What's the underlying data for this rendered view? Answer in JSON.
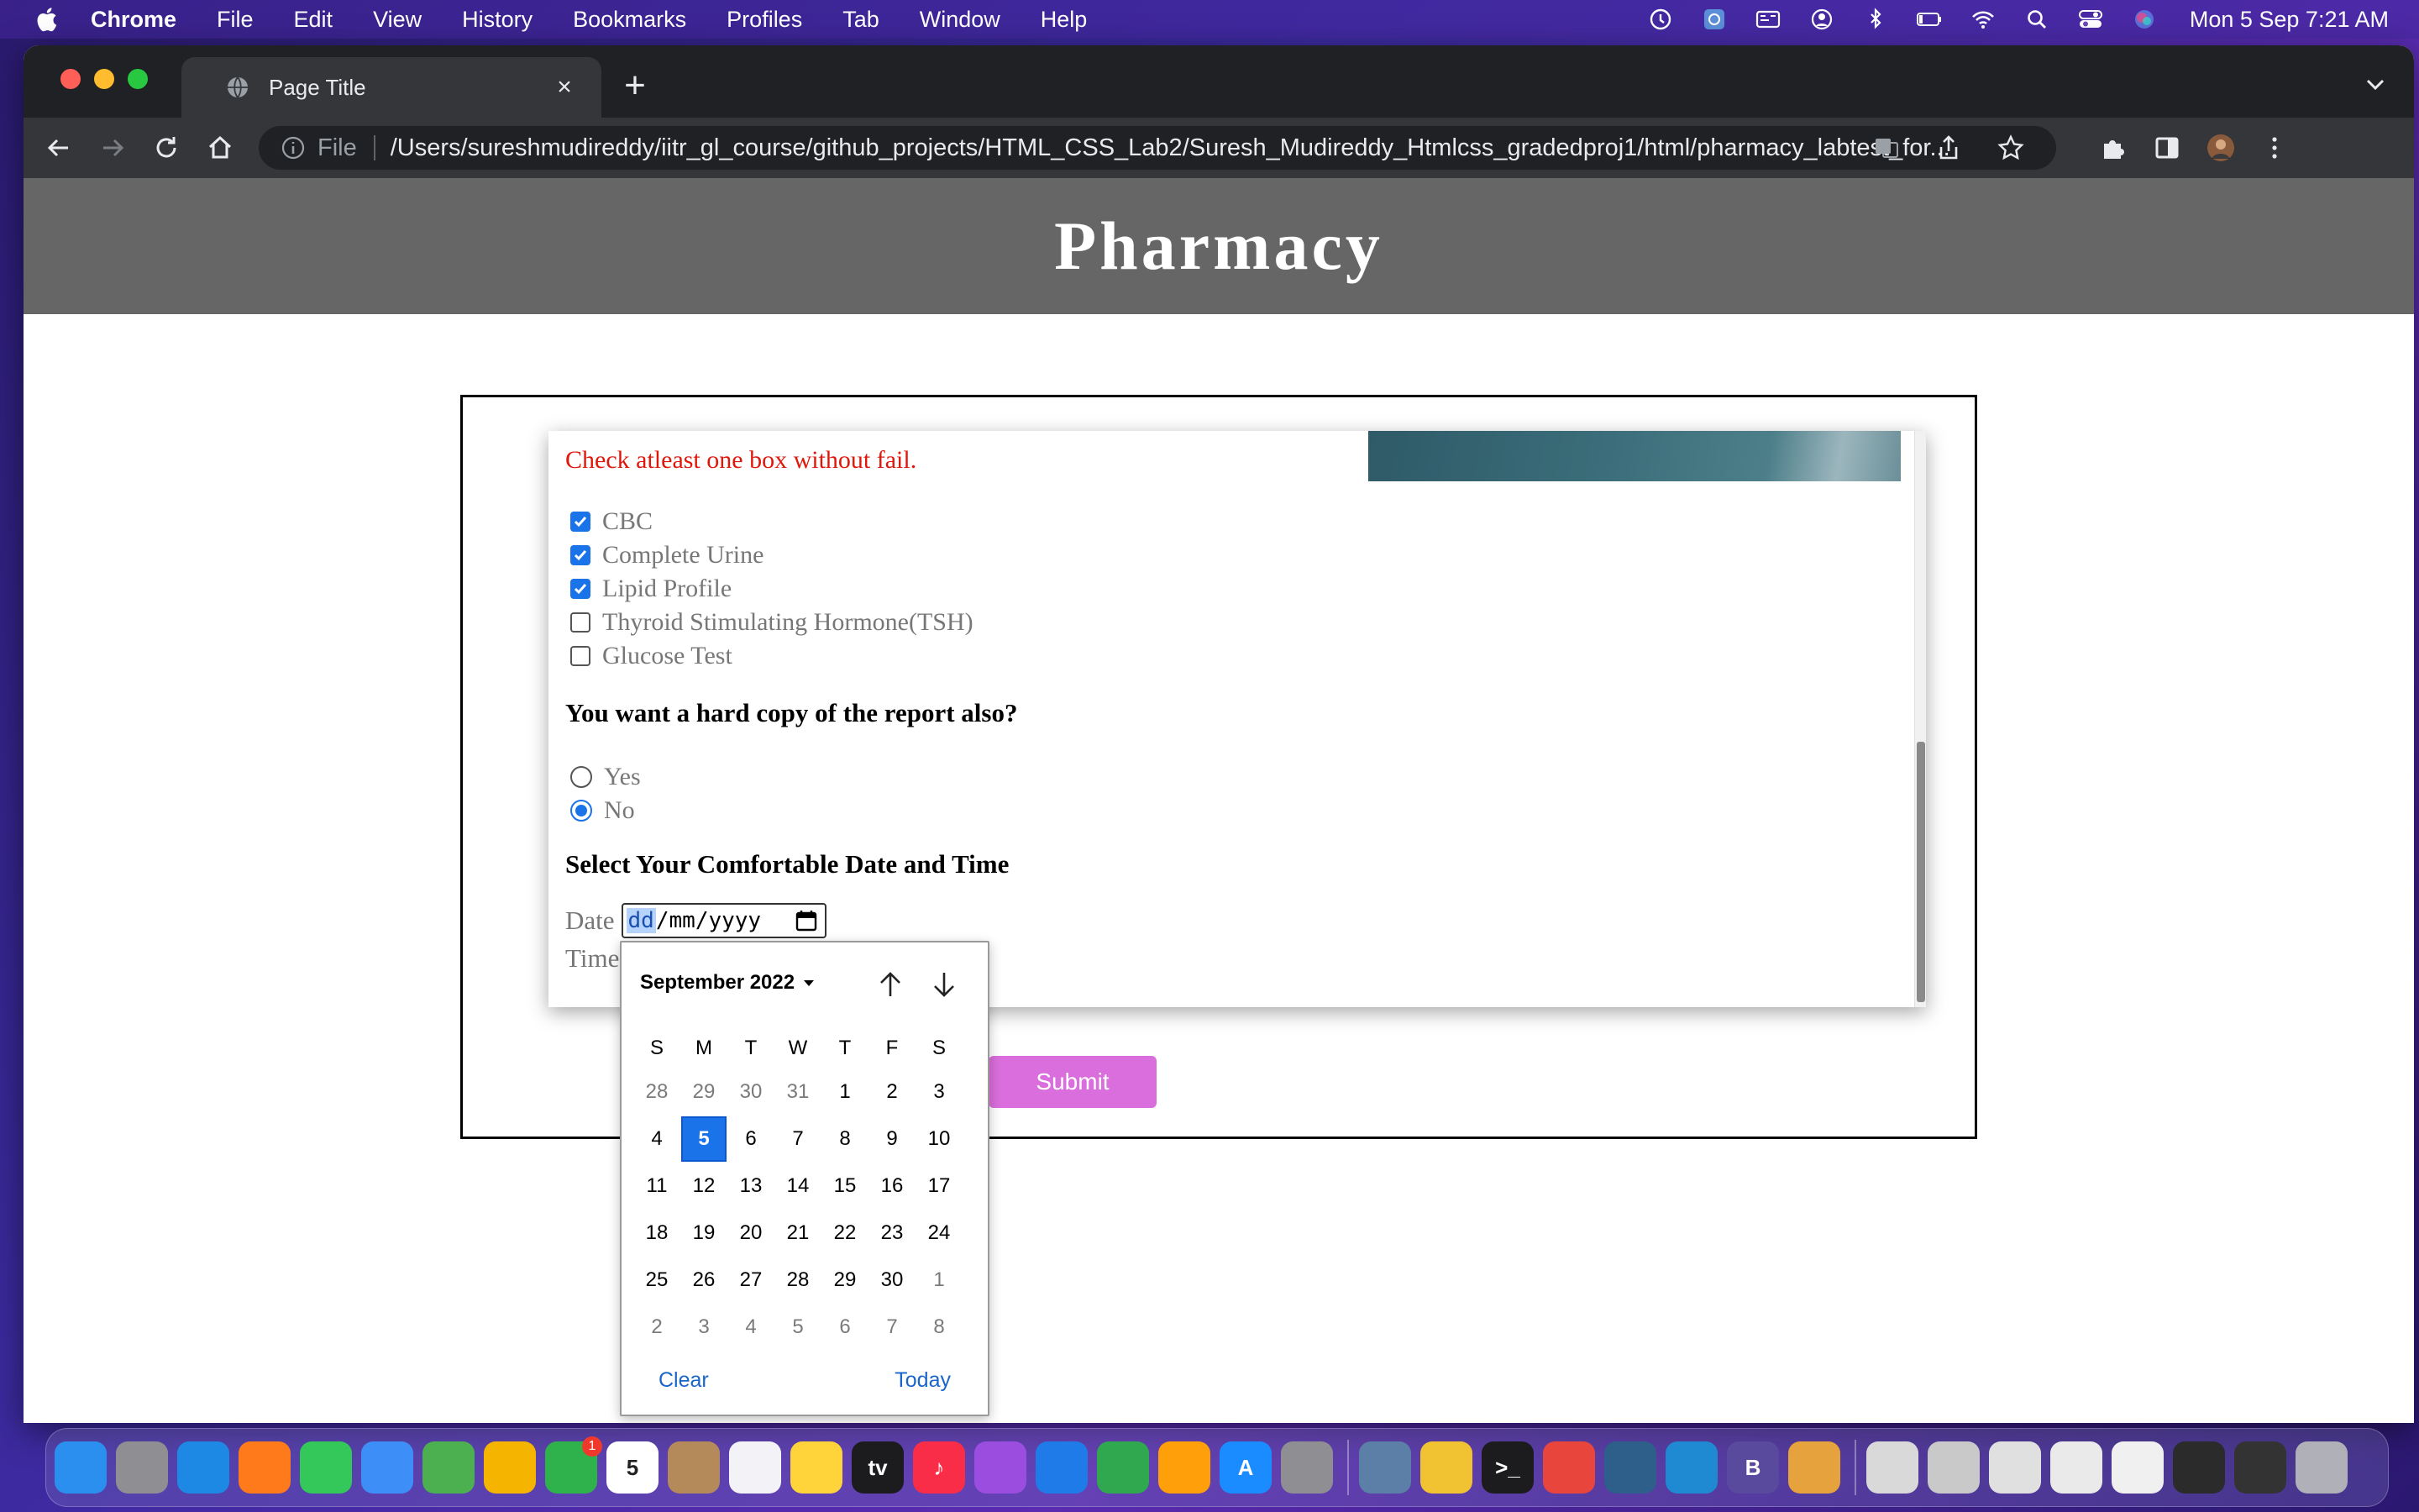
{
  "menubar": {
    "items": [
      "Chrome",
      "File",
      "Edit",
      "View",
      "History",
      "Bookmarks",
      "Profiles",
      "Tab",
      "Window",
      "Help"
    ],
    "clock": "Mon 5 Sep  7:21 AM"
  },
  "browser": {
    "tab_title": "Page Title",
    "url_scheme": "File",
    "url": "/Users/sureshmudireddy/iitr_gl_course/github_projects/HTML_CSS_Lab2/Suresh_Mudireddy_Htmlcss_gradedproj1/html/pharmacy_labtest_for..."
  },
  "page": {
    "heading": "Pharmacy",
    "warning": "Check atleast one box without fail.",
    "tests": [
      {
        "label": "CBC",
        "checked": true
      },
      {
        "label": "Complete Urine",
        "checked": true
      },
      {
        "label": "Lipid Profile",
        "checked": true
      },
      {
        "label": "Thyroid Stimulating Hormone(TSH)",
        "checked": false
      },
      {
        "label": "Glucose Test",
        "checked": false
      }
    ],
    "hardcopy_question": "You want a hard copy of the report also?",
    "hardcopy_options": [
      {
        "label": "Yes",
        "checked": false
      },
      {
        "label": "No",
        "checked": true
      }
    ],
    "datetime_heading": "Select Your Comfortable Date and Time",
    "date_label": "Date",
    "date_placeholder": {
      "dd": "dd",
      "mm": "mm",
      "yyyy": "yyyy"
    },
    "time_label": "Time",
    "submit_label": "Submit"
  },
  "datepicker": {
    "month_label": "September 2022",
    "weekdays": [
      "S",
      "M",
      "T",
      "W",
      "T",
      "F",
      "S"
    ],
    "weeks": [
      [
        {
          "d": "28",
          "m": true
        },
        {
          "d": "29",
          "m": true
        },
        {
          "d": "30",
          "m": true
        },
        {
          "d": "31",
          "m": true
        },
        {
          "d": "1"
        },
        {
          "d": "2"
        },
        {
          "d": "3"
        }
      ],
      [
        {
          "d": "4"
        },
        {
          "d": "5",
          "sel": true
        },
        {
          "d": "6"
        },
        {
          "d": "7"
        },
        {
          "d": "8"
        },
        {
          "d": "9"
        },
        {
          "d": "10"
        }
      ],
      [
        {
          "d": "11"
        },
        {
          "d": "12"
        },
        {
          "d": "13"
        },
        {
          "d": "14"
        },
        {
          "d": "15"
        },
        {
          "d": "16"
        },
        {
          "d": "17"
        }
      ],
      [
        {
          "d": "18"
        },
        {
          "d": "19"
        },
        {
          "d": "20"
        },
        {
          "d": "21"
        },
        {
          "d": "22"
        },
        {
          "d": "23"
        },
        {
          "d": "24"
        }
      ],
      [
        {
          "d": "25"
        },
        {
          "d": "26"
        },
        {
          "d": "27"
        },
        {
          "d": "28"
        },
        {
          "d": "29"
        },
        {
          "d": "30"
        },
        {
          "d": "1",
          "m": true
        }
      ],
      [
        {
          "d": "2",
          "m": true
        },
        {
          "d": "3",
          "m": true
        },
        {
          "d": "4",
          "m": true
        },
        {
          "d": "5",
          "m": true
        },
        {
          "d": "6",
          "m": true
        },
        {
          "d": "7",
          "m": true
        },
        {
          "d": "8",
          "m": true
        }
      ]
    ],
    "clear_label": "Clear",
    "today_label": "Today"
  },
  "dock": {
    "apps": [
      {
        "name": "finder",
        "color": "#2b8ff0",
        "glyph": ""
      },
      {
        "name": "launchpad",
        "color": "#8e8e93",
        "glyph": ""
      },
      {
        "name": "safari",
        "color": "#1e88e5",
        "glyph": ""
      },
      {
        "name": "firefox",
        "color": "#ff7a1a",
        "glyph": ""
      },
      {
        "name": "messages",
        "color": "#34c759",
        "glyph": ""
      },
      {
        "name": "mail",
        "color": "#3d8ef7",
        "glyph": ""
      },
      {
        "name": "maps",
        "color": "#4cb050",
        "glyph": ""
      },
      {
        "name": "photos",
        "color": "#f4b400",
        "glyph": ""
      },
      {
        "name": "facetime",
        "color": "#2fb24c",
        "glyph": "",
        "badge": "1"
      },
      {
        "name": "calendar",
        "color": "#ffffff",
        "glyph": "5"
      },
      {
        "name": "contacts",
        "color": "#b48a5a",
        "glyph": ""
      },
      {
        "name": "reminders",
        "color": "#f2f2f7",
        "glyph": ""
      },
      {
        "name": "notes",
        "color": "#ffd43b",
        "glyph": ""
      },
      {
        "name": "apple-tv",
        "color": "#1c1c1e",
        "glyph": "tv"
      },
      {
        "name": "music",
        "color": "#fa2d48",
        "glyph": "♪"
      },
      {
        "name": "podcasts",
        "color": "#9b4de0",
        "glyph": ""
      },
      {
        "name": "keynote",
        "color": "#1e7be8",
        "glyph": ""
      },
      {
        "name": "numbers",
        "color": "#2fa84f",
        "glyph": ""
      },
      {
        "name": "pages",
        "color": "#ff9f0a",
        "glyph": ""
      },
      {
        "name": "app-store",
        "color": "#1a8cff",
        "glyph": "A"
      },
      {
        "name": "system-preferences",
        "color": "#8e8e93",
        "glyph": ""
      },
      {
        "name": "sep"
      },
      {
        "name": "preview",
        "color": "#5b7fa6",
        "glyph": ""
      },
      {
        "name": "files",
        "color": "#f1c232",
        "glyph": ""
      },
      {
        "name": "terminal",
        "color": "#1c1c1e",
        "glyph": ">_"
      },
      {
        "name": "chrome",
        "color": "#e8453c",
        "glyph": ""
      },
      {
        "name": "mysql-workbench",
        "color": "#2e5f8a",
        "glyph": ""
      },
      {
        "name": "vscode",
        "color": "#1f8ad2",
        "glyph": ""
      },
      {
        "name": "bbedit",
        "color": "#5a4a9e",
        "glyph": "B"
      },
      {
        "name": "xcode-tool",
        "color": "#e6a23c",
        "glyph": ""
      },
      {
        "name": "sep"
      },
      {
        "name": "window-thumb-1",
        "color": "#d9d9d9",
        "glyph": ""
      },
      {
        "name": "window-thumb-2",
        "color": "#c9c9c9",
        "glyph": ""
      },
      {
        "name": "window-thumb-3",
        "color": "#e0e0e0",
        "glyph": ""
      },
      {
        "name": "window-thumb-4",
        "color": "#eaeaea",
        "glyph": ""
      },
      {
        "name": "window-thumb-5",
        "color": "#f0f0f0",
        "glyph": ""
      },
      {
        "name": "window-thumb-6",
        "color": "#2b2b2b",
        "glyph": ""
      },
      {
        "name": "window-thumb-7",
        "color": "#333333",
        "glyph": ""
      },
      {
        "name": "trash",
        "color": "#b0b0b8",
        "glyph": ""
      }
    ]
  },
  "colors": {
    "header_bg": "#666666",
    "warning": "#e0180c",
    "accent": "#1a73e8",
    "submit_bg": "#da6edc"
  }
}
